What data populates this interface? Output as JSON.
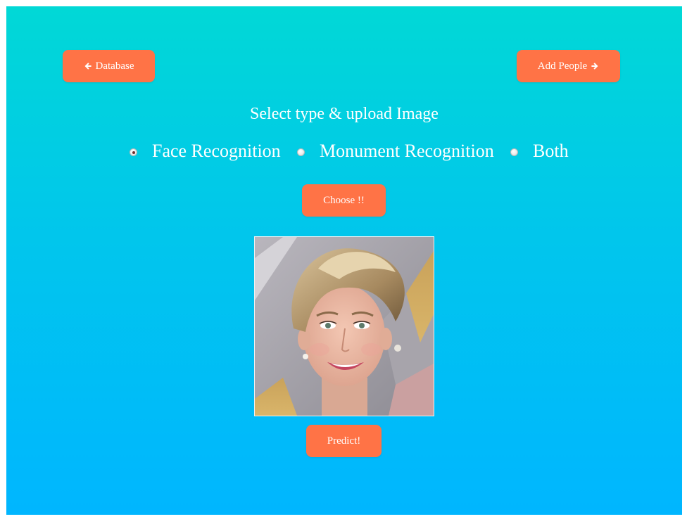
{
  "nav": {
    "database_label": "Database",
    "add_people_label": "Add People"
  },
  "heading": "Select type & upload Image",
  "options": [
    {
      "label": "Face Recognition",
      "checked": true
    },
    {
      "label": "Monument Recognition",
      "checked": false
    },
    {
      "label": "Both",
      "checked": false
    }
  ],
  "choose_label": "Choose !!",
  "predict_label": "Predict!",
  "colors": {
    "button": "#ff7346",
    "gradient_top": "#01d8d6",
    "gradient_bottom": "#00b6ff",
    "text": "#ffffff"
  },
  "icons": {
    "database_button": "arrow-left-icon",
    "add_people_button": "arrow-right-icon"
  }
}
